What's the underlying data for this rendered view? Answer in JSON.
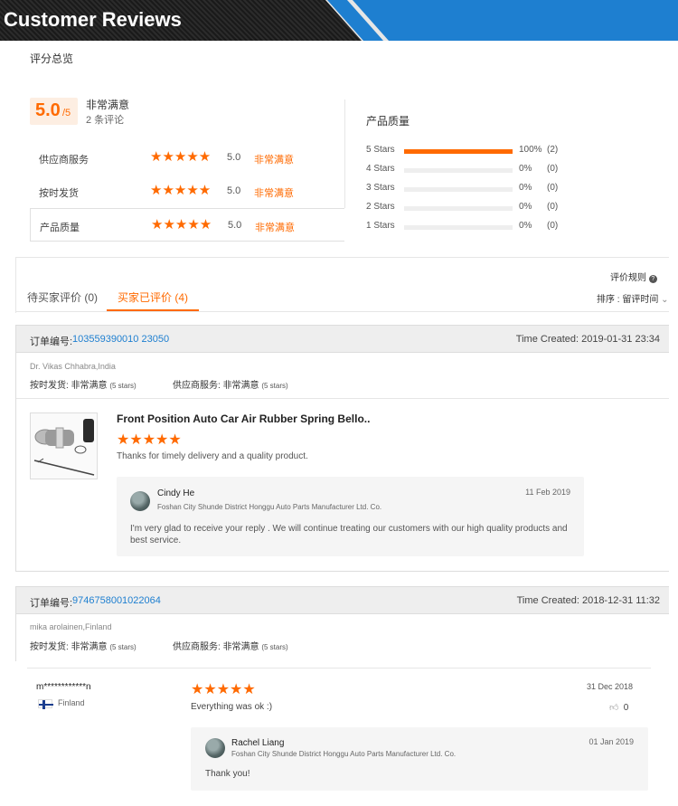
{
  "banner": {
    "title": "Customer Reviews"
  },
  "overview": {
    "label": "评分总览",
    "score": "5.0",
    "denominator": "/5",
    "rating_text": "非常满意",
    "review_count": "2 条评论",
    "sub_ratings": [
      {
        "label": "供应商服务",
        "stars": "★★★★★",
        "value": "5.0",
        "text": "非常满意"
      },
      {
        "label": "按时发货",
        "stars": "★★★★★",
        "value": "5.0",
        "text": "非常满意"
      },
      {
        "label": "产品质量",
        "stars": "★★★★★",
        "value": "5.0",
        "text": "非常满意"
      }
    ]
  },
  "product_quality": {
    "title": "产品质量",
    "rows": [
      {
        "name": "5 Stars",
        "pct": "100%",
        "count": "(2)",
        "fraction": 1.0
      },
      {
        "name": "4 Stars",
        "pct": "0%",
        "count": "(0)",
        "fraction": 0
      },
      {
        "name": "3 Stars",
        "pct": "0%",
        "count": "(0)",
        "fraction": 0
      },
      {
        "name": "2 Stars",
        "pct": "0%",
        "count": "(0)",
        "fraction": 0
      },
      {
        "name": "1 Stars",
        "pct": "0%",
        "count": "(0)",
        "fraction": 0
      }
    ]
  },
  "toolbar": {
    "rules": "评价规则",
    "sort": "排序 : 留评时间",
    "tab_pending": "待买家评价 (0)",
    "tab_reviewed": "买家已评价 (4)"
  },
  "colors": {
    "accent": "#ff6a00",
    "link": "#1e7fd0"
  },
  "orders": [
    {
      "label": "订单编号:",
      "number": "103559390010 23050",
      "time": "Time Created: 2019-01-31 23:34",
      "buyer": "Dr. Vikas Chhabra,India",
      "delivery_label": "按时发货:",
      "delivery_value": "非常满意",
      "delivery_stars": "(5 stars)",
      "service_label": "供应商服务:",
      "service_value": "非常满意",
      "service_stars": "(5 stars)",
      "product_title": "Front Position Auto Car Air Rubber Spring Bello..",
      "review_stars": "★★★★★",
      "review_text": "Thanks for timely delivery and a quality product.",
      "reply": {
        "name": "Cindy He",
        "company": "Foshan City Shunde District Honggu Auto Parts Manufacturer Ltd. Co.",
        "date": "11 Feb 2019",
        "text": "I'm very glad to receive your reply . We will continue  treating our customers with our high quality products and best service."
      }
    },
    {
      "label": "订单编号:",
      "number": "9746758001022064",
      "time": "Time Created: 2018-12-31 11:32",
      "buyer": "mika arolainen,Finland",
      "delivery_label": "按时发货:",
      "delivery_value": "非常满意",
      "delivery_stars": "(5 stars)",
      "service_label": "供应商服务:",
      "service_value": "非常满意",
      "service_stars": "(5 stars)"
    }
  ],
  "review2": {
    "user": "m************n",
    "country": "Finland",
    "stars": "★★★★★",
    "text": "Everything was ok :)",
    "date": "31 Dec 2018",
    "likes": "0",
    "reply": {
      "name": "Rachel Liang",
      "company": "Foshan City Shunde District Honggu Auto Parts Manufacturer Ltd. Co.",
      "date": "01 Jan 2019",
      "text": "Thank you!"
    }
  }
}
